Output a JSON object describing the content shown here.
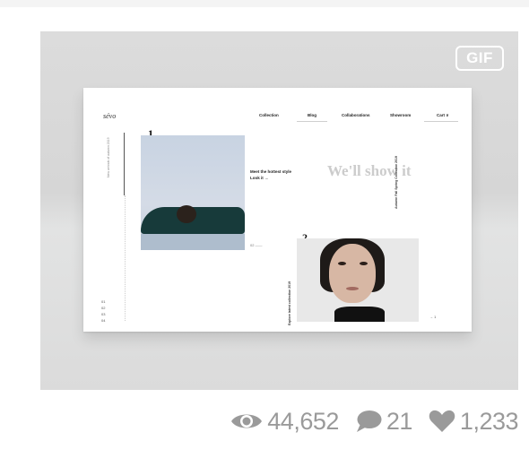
{
  "shot": {
    "badge": "GIF",
    "mock": {
      "logo": "sévo",
      "nav": [
        {
          "label": "Collection"
        },
        {
          "label": "Blog"
        },
        {
          "label": "Collaborations"
        },
        {
          "label": "Showroom"
        },
        {
          "label": "Cart ∨"
        }
      ],
      "side_text": "New arrivals of autumn 2019",
      "side_markers": [
        "01",
        "02",
        "03",
        "04"
      ],
      "number_one": "1",
      "number_two": "2",
      "caption_title": "Meet the hottest style",
      "caption_link": "Look it →",
      "headline": "We'll show it",
      "vertical_caption_right": "Autumn Fall Spring Collection 2019",
      "vertical_caption_bottom": "Explore latest collection 2019",
      "dash": "02 ——",
      "page_indicator": "→ 1"
    }
  },
  "stats": {
    "views": "44,652",
    "comments": "21",
    "likes": "1,233"
  },
  "icons": {
    "views": "eye-icon",
    "comments": "speech-bubble-icon",
    "likes": "heart-icon"
  }
}
